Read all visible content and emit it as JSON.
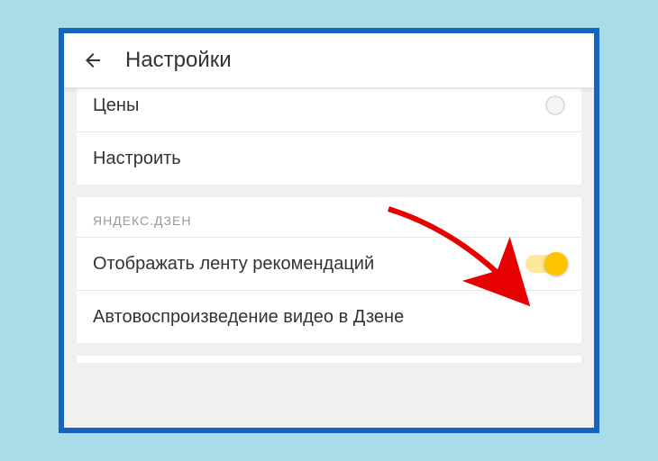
{
  "header": {
    "title": "Настройки"
  },
  "section1": {
    "row_prices": "Цены",
    "row_configure": "Настроить"
  },
  "section2": {
    "header": "ЯНДЕКС.ДЗЕН",
    "row_feed": "Отображать ленту рекомендаций",
    "row_autoplay": "Автовоспроизведение видео в Дзене"
  },
  "annotation": {
    "arrow_color": "#e60000"
  }
}
